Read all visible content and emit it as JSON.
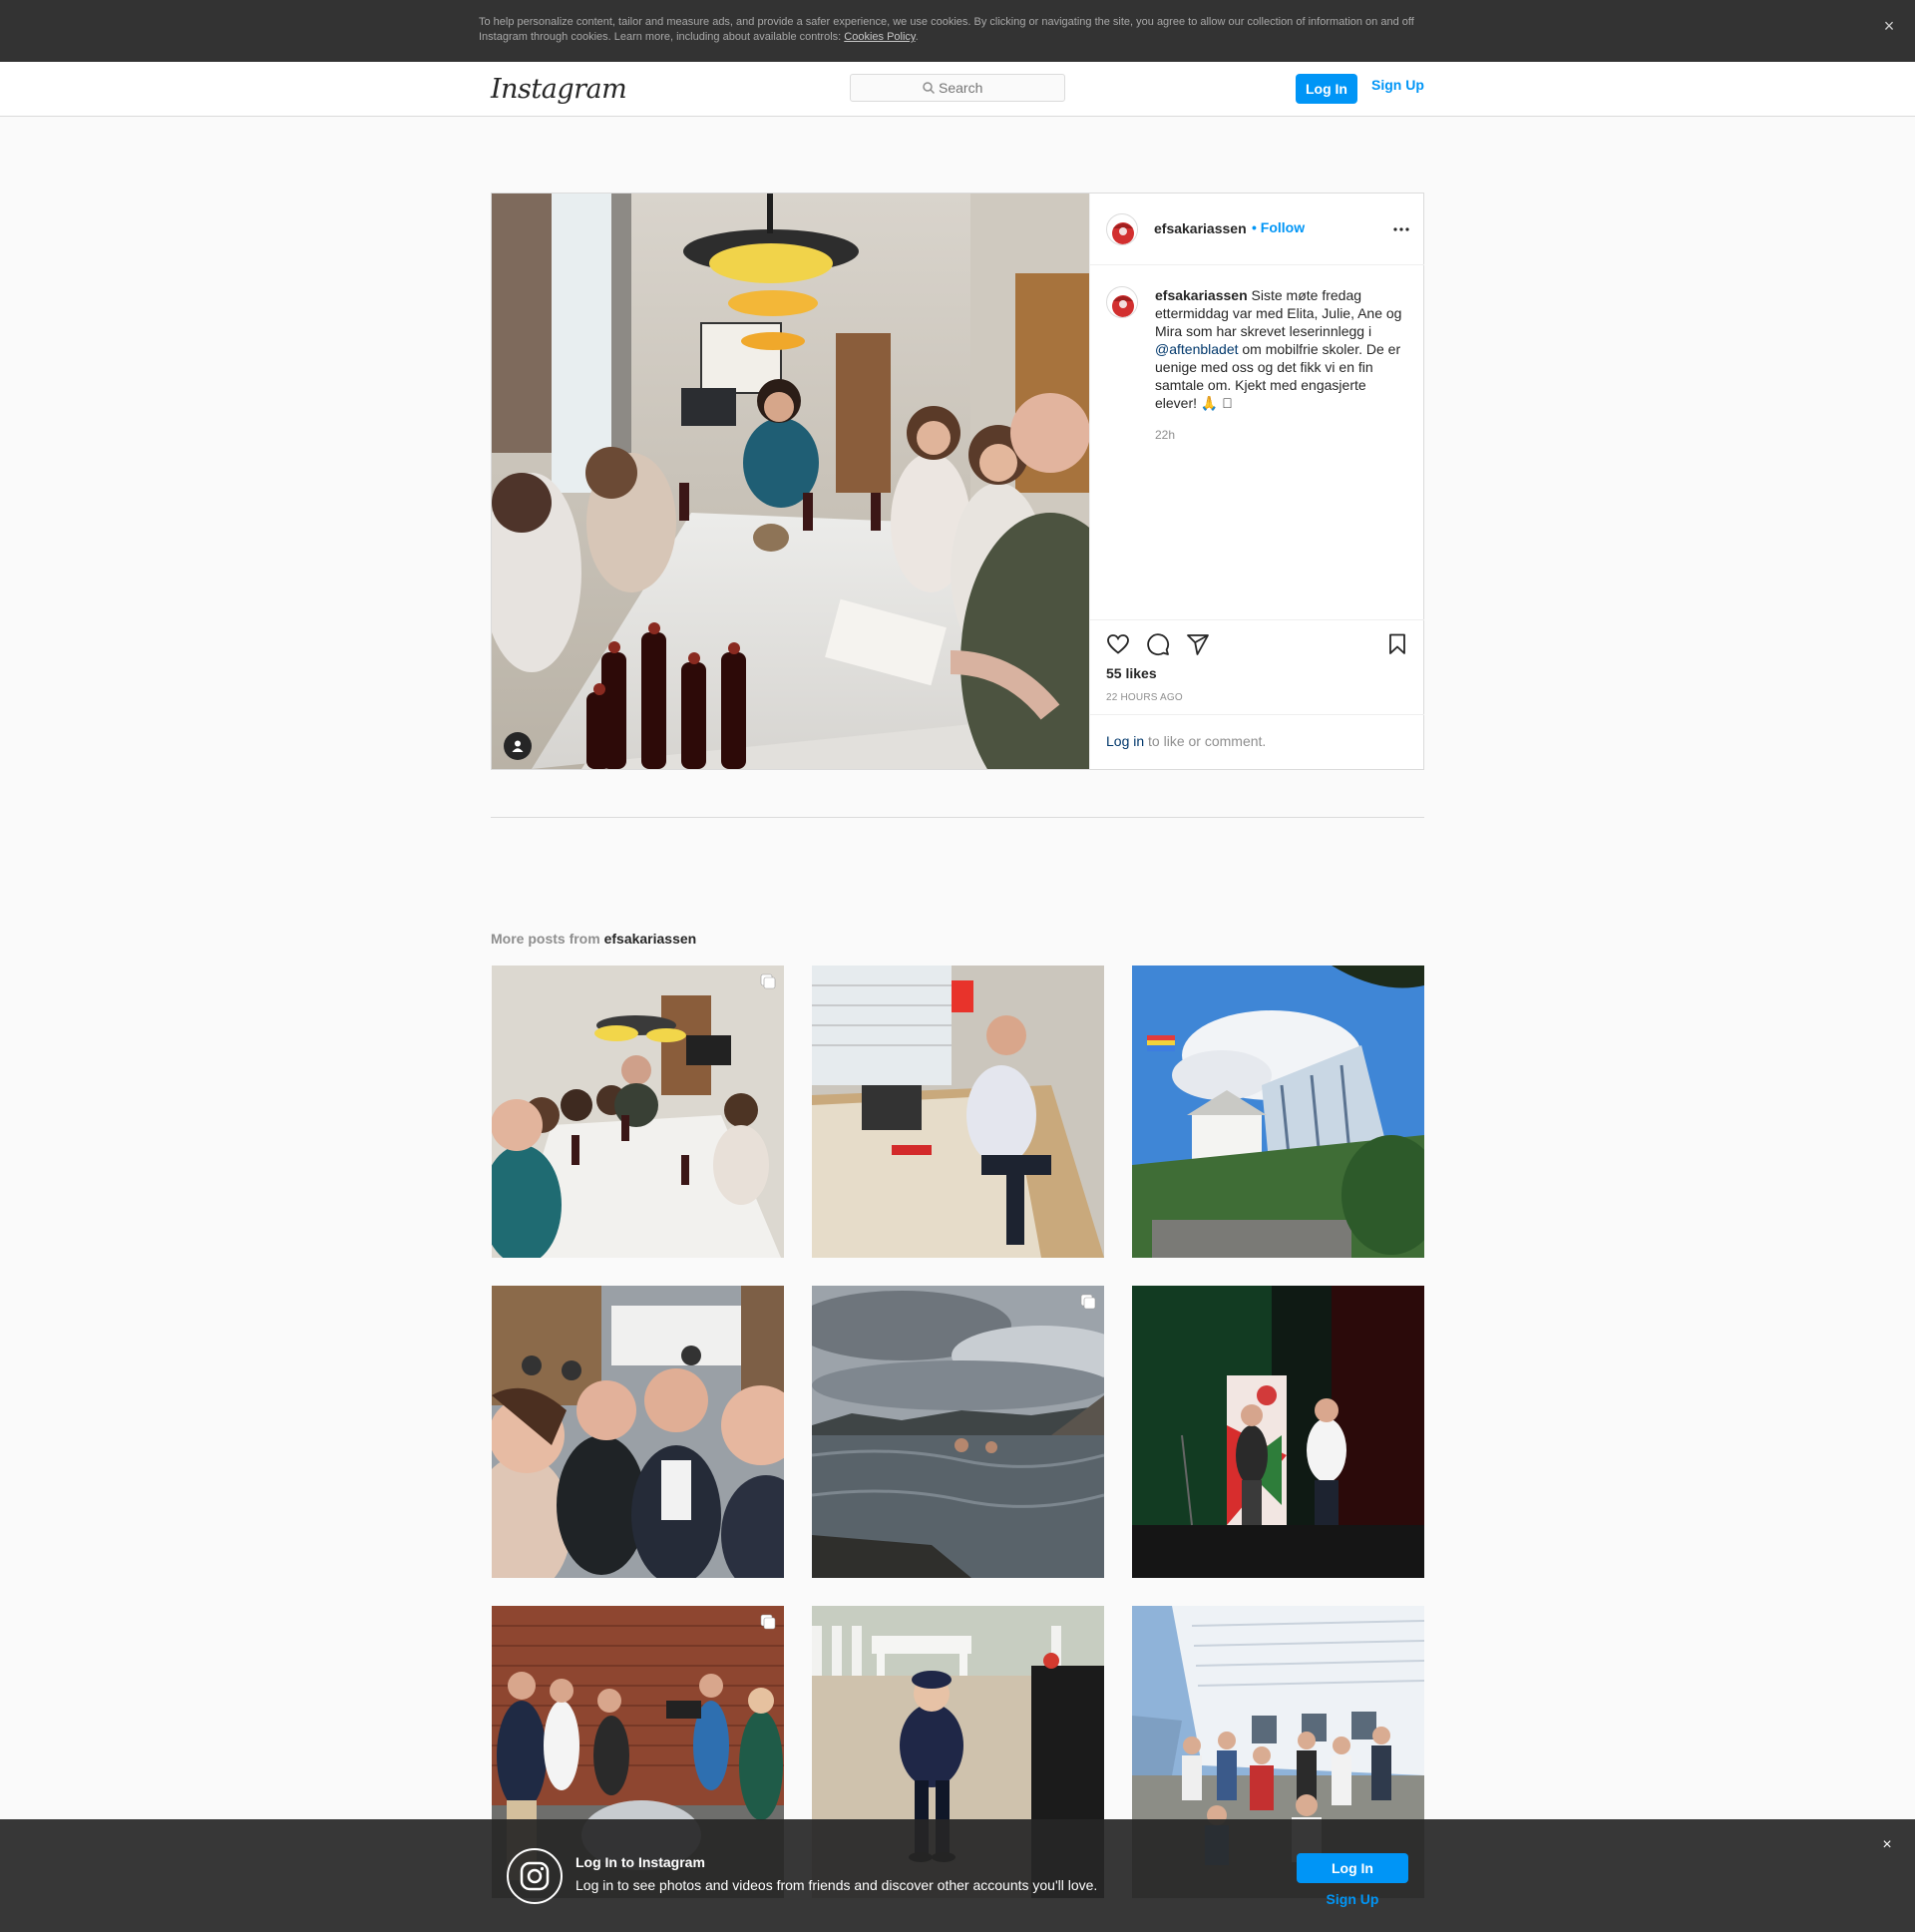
{
  "cookie_banner": {
    "text": "To help personalize content, tailor and measure ads, and provide a safer experience, we use cookies. By clicking or navigating the site, you agree to allow our collection of information on and off Instagram through cookies. Learn more, including about available controls: ",
    "link_label": "Cookies Policy",
    "period": ".",
    "close_label": "×"
  },
  "header": {
    "logo_text": "Instagram",
    "search_placeholder": "Search",
    "login_label": "Log In",
    "signup_label": "Sign Up"
  },
  "post": {
    "username": "efsakariassen",
    "follow_label": "• Follow",
    "caption_username": "efsakariassen",
    "caption_text_1": " Siste møte fredag ettermiddag var med Elita, Julie, Ane og Mira som har skrevet leserinnlegg i ",
    "caption_mention": "@aftenbladet",
    "caption_text_2": " om mobilfrie skoler. De er uenige med oss og det fikk vi en fin samtale om. Kjekt med engasjerte elever! 🙏 🏻",
    "caption_time": "22h",
    "likes": "55 likes",
    "timestamp": "22 HOURS AGO",
    "comment_login_link": "Log in",
    "comment_suffix": " to like or comment."
  },
  "more_posts": {
    "prefix": "More posts from ",
    "username": "efsakariassen"
  },
  "grid": [
    {
      "kind": "meeting-table",
      "multi": true
    },
    {
      "kind": "man-red-card",
      "multi": false
    },
    {
      "kind": "building-sky",
      "multi": false
    },
    {
      "kind": "selfie-group",
      "multi": false
    },
    {
      "kind": "sea-swim",
      "multi": true
    },
    {
      "kind": "stage",
      "multi": false
    },
    {
      "kind": "brick-wall-crew",
      "multi": true
    },
    {
      "kind": "child-photo",
      "multi": false
    },
    {
      "kind": "hotel-group",
      "multi": false
    }
  ],
  "bottom_banner": {
    "title": "Log In to Instagram",
    "subtitle": "Log in to see photos and videos from friends and discover other accounts you'll love.",
    "login_label": "Log In",
    "signup_label": "Sign Up",
    "close_label": "×"
  },
  "colors": {
    "accent": "#0095f6",
    "mention": "#00376b",
    "muted": "#8e8e8e",
    "banner_bg": "#262626"
  }
}
